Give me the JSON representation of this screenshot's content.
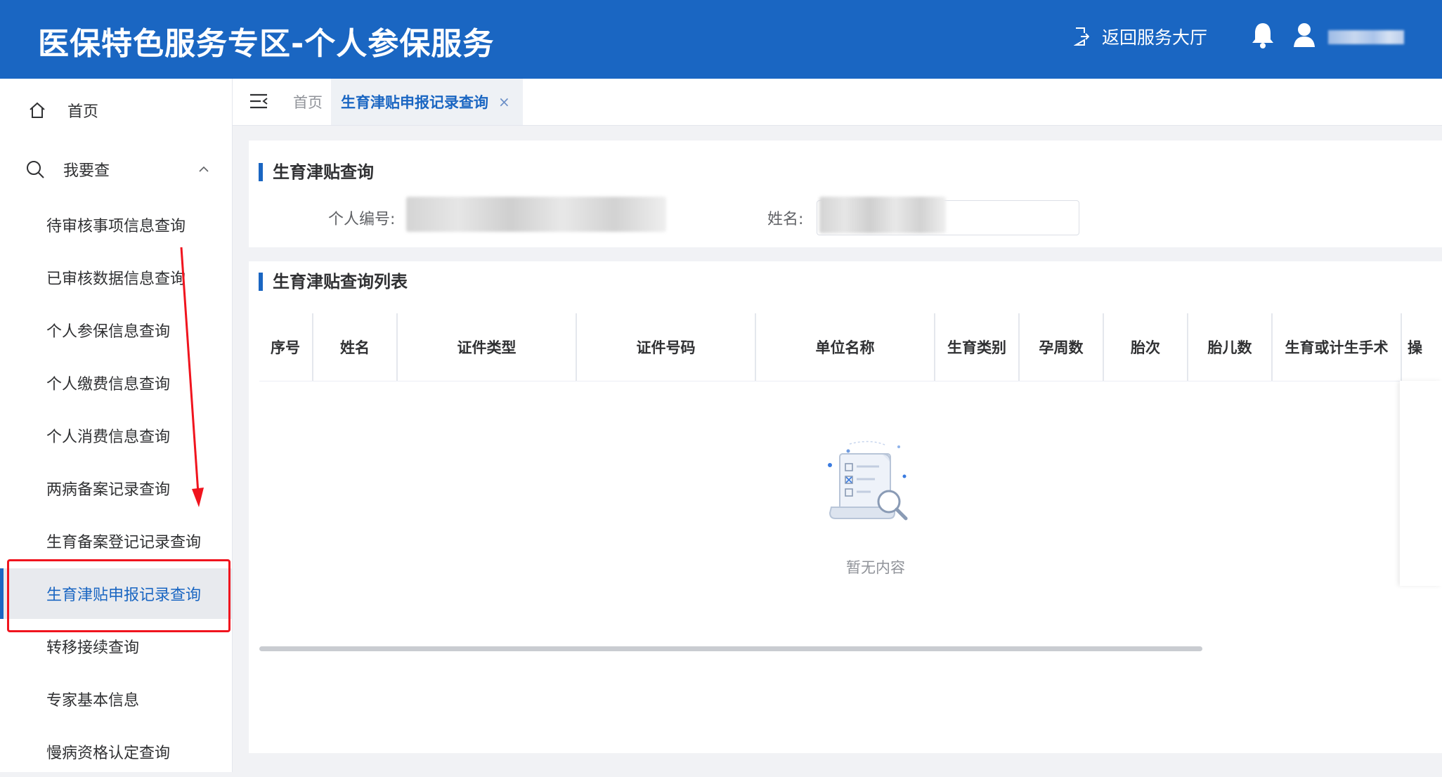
{
  "header": {
    "title": "医保特色服务专区-个人参保服务",
    "back_link": "返回服务大厅",
    "user_name": "用户"
  },
  "sidebar": {
    "home": "首页",
    "query_group": "我要查",
    "items": [
      "待审核事项信息查询",
      "已审核数据信息查询",
      "个人参保信息查询",
      "个人缴费信息查询",
      "个人消费信息查询",
      "两病备案记录查询",
      "生育备案登记记录查询",
      "生育津贴申报记录查询",
      "转移接续查询",
      "专家基本信息",
      "慢病资格认定查询"
    ],
    "active_index": 7
  },
  "tabs": {
    "home": "首页",
    "active": "生育津贴申报记录查询",
    "close": "×"
  },
  "query": {
    "title": "生育津贴查询",
    "person_id_label": "个人编号:",
    "name_label": "姓名:"
  },
  "list": {
    "title": "生育津贴查询列表",
    "columns": [
      "序号",
      "姓名",
      "证件类型",
      "证件号码",
      "单位名称",
      "生育类别",
      "孕周数",
      "胎次",
      "胎儿数",
      "生育或计生手术",
      "操"
    ],
    "empty_text": "暂无内容"
  },
  "colors": {
    "header_bg": "#1a66c2",
    "accent": "#1a66c2",
    "annotation": "#f0141e"
  }
}
